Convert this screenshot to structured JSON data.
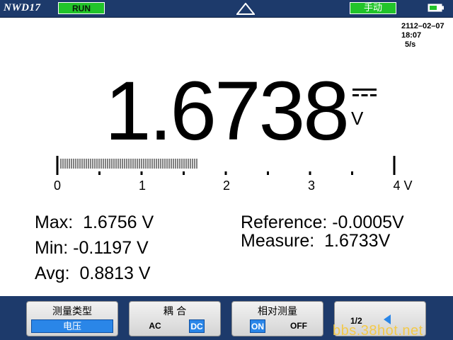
{
  "header": {
    "brand": "NWD17",
    "status": "RUN",
    "mode": "手动",
    "icons": {
      "trigger": "triangle-icon",
      "battery": "battery-icon"
    },
    "colors": {
      "bar": "#1d3a6b",
      "badge": "#22c42a"
    }
  },
  "datetime": {
    "date": "2112–02–07",
    "time": "18:07",
    "rate": "5/s"
  },
  "reading": {
    "value": "1.6738",
    "unit": "V",
    "coupling_icon": "dc-symbol-icon"
  },
  "scale": {
    "labels": [
      "0",
      "1",
      "2",
      "3",
      "4 V"
    ],
    "min": 0,
    "max": 4,
    "bar_value": 1.6738
  },
  "stats": {
    "max": "Max:  1.6756 V",
    "min": "Min: -0.1197 V",
    "avg": "Avg:  0.8813 V",
    "reference": "Reference: -0.0005V",
    "measure": "Measure:  1.6733V"
  },
  "softkeys": {
    "type": {
      "title": "测量类型",
      "value": "电压"
    },
    "coupling": {
      "title": "耦    合",
      "options": [
        "AC",
        "DC"
      ],
      "selected": "DC"
    },
    "relative": {
      "title": "相对测量",
      "options": [
        "ON",
        "OFF"
      ],
      "selected": "ON"
    },
    "page": {
      "label": "1/2",
      "icon": "left-arrow-icon"
    }
  },
  "watermark": "bbs.38hot.net"
}
